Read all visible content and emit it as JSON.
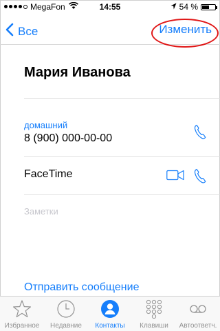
{
  "status_bar": {
    "carrier": "MegaFon",
    "time": "14:55",
    "battery_percent": "54 %",
    "battery_level": 0.54,
    "signal_bars": 4
  },
  "nav": {
    "back_label": "Все",
    "edit_label": "Изменить"
  },
  "contact": {
    "name": "Мария Иванова"
  },
  "phone": {
    "type_label": "домашний",
    "number": "8 (900) 000-00-00"
  },
  "facetime": {
    "label": "FaceTime"
  },
  "notes": {
    "placeholder": "Заметки"
  },
  "actions": {
    "send_message": "Отправить сообщение"
  },
  "tab_bar": {
    "active_tab": "Контакты",
    "tabs": [
      {
        "label": "Избранное",
        "icon": "star-icon"
      },
      {
        "label": "Недавние",
        "icon": "clock-icon"
      },
      {
        "label": "Контакты",
        "icon": "person-icon"
      },
      {
        "label": "Клавиши",
        "icon": "keypad-icon"
      },
      {
        "label": "Автоответч.",
        "icon": "voicemail-icon"
      }
    ]
  },
  "colors": {
    "accent": "#157efb",
    "highlight": "#e01717",
    "inactive": "#929292",
    "placeholder": "#c7c7cd"
  }
}
